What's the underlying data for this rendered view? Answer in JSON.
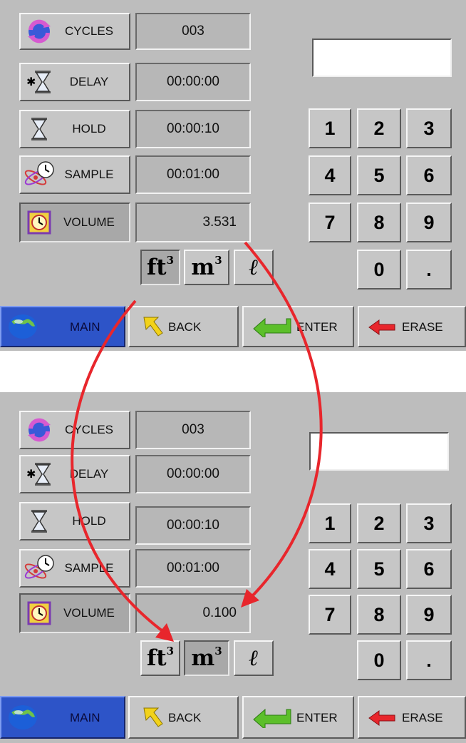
{
  "panels": [
    {
      "settings": [
        {
          "label": "CYCLES",
          "icon": "cycle-arrows-icon",
          "value": "003"
        },
        {
          "label": "DELAY",
          "icon": "hourglass-star-icon",
          "value": "00:00:00"
        },
        {
          "label": "HOLD",
          "icon": "hourglass-icon",
          "value": "00:00:10"
        },
        {
          "label": "SAMPLE",
          "icon": "clock-atom-icon",
          "value": "00:01:00"
        },
        {
          "label": "VOLUME",
          "icon": "clock-box-icon",
          "value": "3.531"
        }
      ],
      "entry_display": "",
      "keypad": [
        "1",
        "2",
        "3",
        "4",
        "5",
        "6",
        "7",
        "8",
        "9",
        "0",
        "."
      ],
      "units": {
        "ft3_base": "ft",
        "m3_base": "m",
        "sup": "3",
        "liter": "ℓ",
        "selected": "ft3"
      },
      "nav": {
        "main": "MAIN",
        "back": "BACK",
        "enter": "ENTER",
        "erase": "ERASE"
      }
    },
    {
      "settings": [
        {
          "label": "CYCLES",
          "icon": "cycle-arrows-icon",
          "value": "003"
        },
        {
          "label": "DELAY",
          "icon": "hourglass-star-icon",
          "value": "00:00:00"
        },
        {
          "label": "HOLD",
          "icon": "hourglass-icon",
          "value": "00:00:10"
        },
        {
          "label": "SAMPLE",
          "icon": "clock-atom-icon",
          "value": "00:01:00"
        },
        {
          "label": "VOLUME",
          "icon": "clock-box-icon",
          "value": "0.100"
        }
      ],
      "entry_display": "",
      "keypad": [
        "1",
        "2",
        "3",
        "4",
        "5",
        "6",
        "7",
        "8",
        "9",
        "0",
        "."
      ],
      "units": {
        "ft3_base": "ft",
        "m3_base": "m",
        "sup": "3",
        "liter": "ℓ",
        "selected": "m3"
      },
      "nav": {
        "main": "MAIN",
        "back": "BACK",
        "enter": "ENTER",
        "erase": "ERASE"
      }
    }
  ],
  "colors": {
    "panel_bg": "#bdbdbd",
    "main_button": "#2d54c8",
    "arrow": "#e8262c",
    "back_icon": "#f2d21a",
    "enter_icon": "#5cbf2a",
    "erase_icon": "#e8262c"
  }
}
